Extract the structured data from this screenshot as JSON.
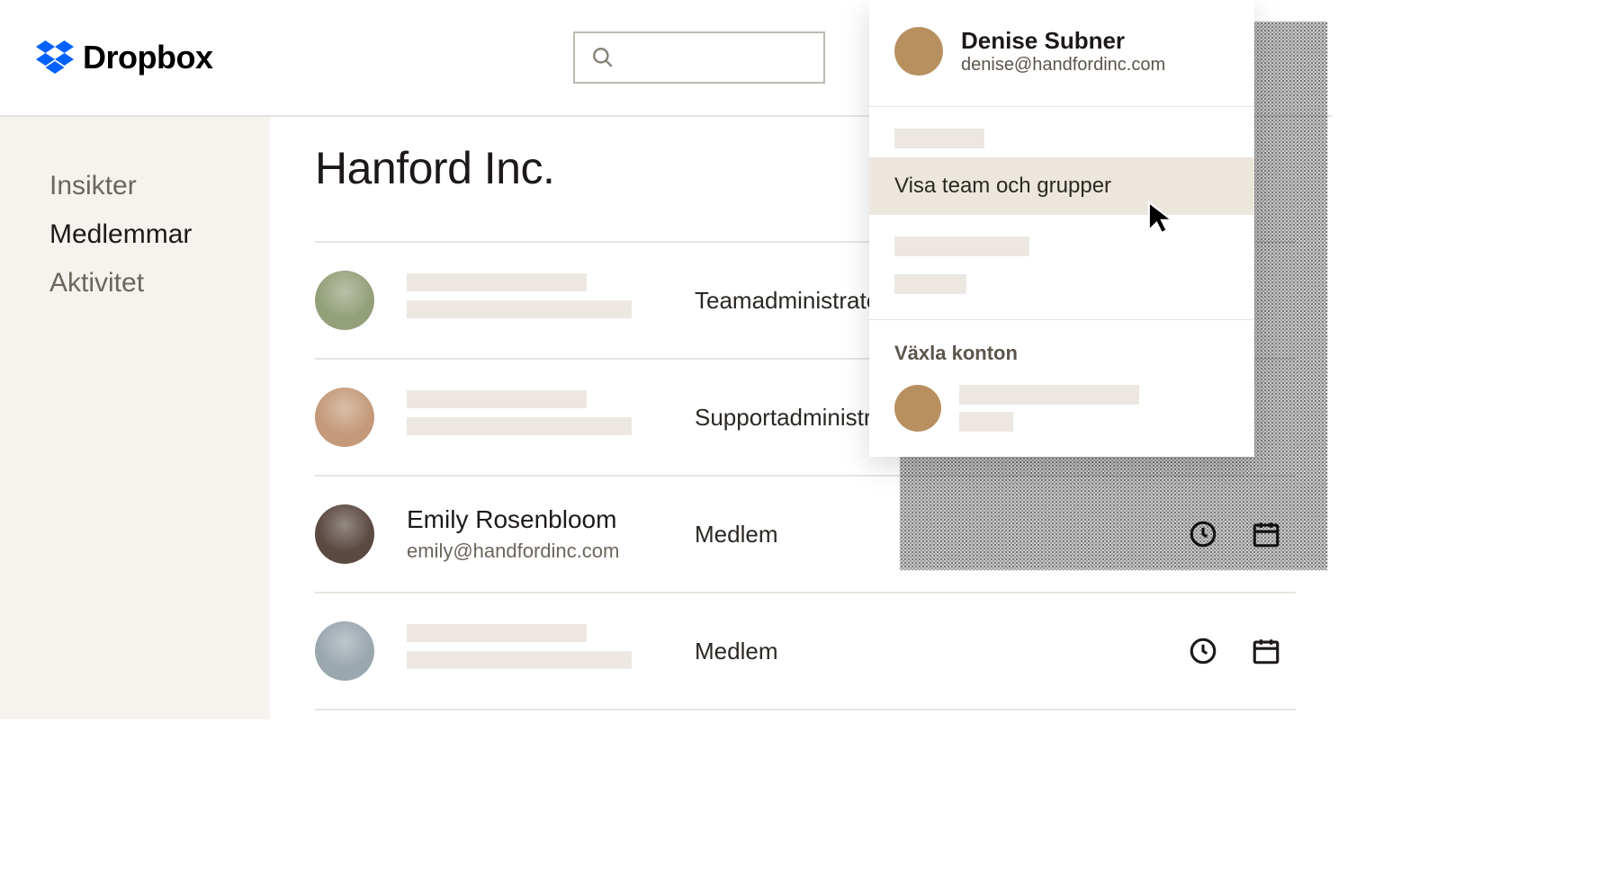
{
  "brand": "Dropbox",
  "sidebar": {
    "items": [
      {
        "label": "Insikter",
        "active": false
      },
      {
        "label": "Medlemmar",
        "active": true
      },
      {
        "label": "Aktivitet",
        "active": false
      }
    ]
  },
  "page": {
    "title": "Hanford Inc."
  },
  "members": [
    {
      "name": "",
      "email": "",
      "role": "Teamadministratör",
      "actions": false,
      "avatar_bg": "#94a07a"
    },
    {
      "name": "",
      "email": "",
      "role": "Supportadministratör",
      "actions": false,
      "avatar_bg": "#c49a7a"
    },
    {
      "name": "Emily Rosenbloom",
      "email": "emily@handfordinc.com",
      "role": "Medlem",
      "actions": true,
      "avatar_bg": "#5b4a42"
    },
    {
      "name": "",
      "email": "",
      "role": "Medlem",
      "actions": true,
      "avatar_bg": "#9aa7ae"
    }
  ],
  "dropdown": {
    "user": {
      "name": "Denise Subner",
      "email": "denise@handfordinc.com"
    },
    "highlighted_item": "Visa team och grupper",
    "switch_label": "Växla konton"
  }
}
